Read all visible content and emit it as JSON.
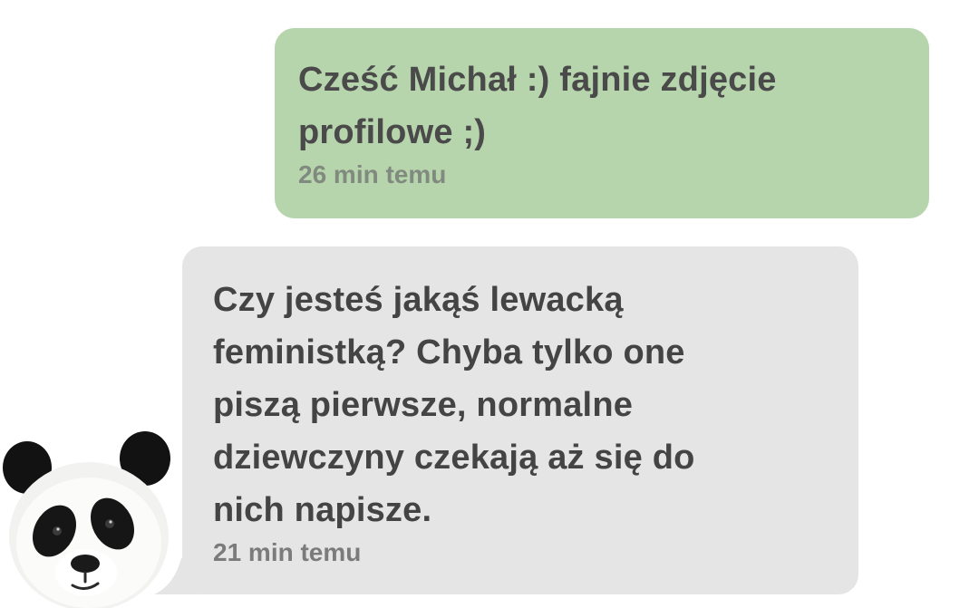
{
  "colors": {
    "outgoing_bubble": "#b7d5ad",
    "incoming_bubble": "#e5e5e5",
    "text": "#444444",
    "timestamp": "#7b7b7b",
    "background": "#ffffff"
  },
  "messages": [
    {
      "direction": "outgoing",
      "text": "Cześć Michał :) fajnie zdjęcie\nprofilowe ;)",
      "time": "26 min temu"
    },
    {
      "direction": "incoming",
      "text": "Czy jesteś jakąś lewacką\nfeministką? Chyba tylko one\npiszą pierwsze, normalne\ndziewczyny czekają aż się do\nnich napisze.",
      "time": "21 min temu",
      "avatar_icon": "panda-avatar-icon"
    }
  ]
}
